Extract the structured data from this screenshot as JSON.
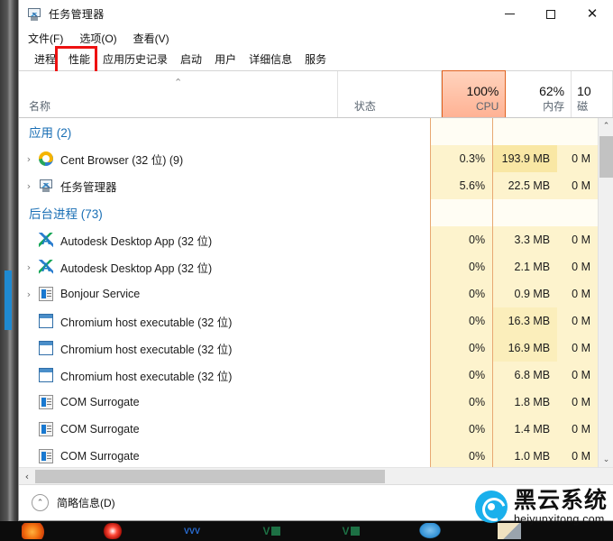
{
  "window": {
    "title": "任务管理器",
    "app_icon": "task-manager-icon",
    "controls": {
      "minimize": "—",
      "maximize": "□",
      "close": "✕"
    }
  },
  "menubar": [
    {
      "label": "文件(F)",
      "mnemonic": "F"
    },
    {
      "label": "选项(O)",
      "mnemonic": "O"
    },
    {
      "label": "查看(V)",
      "mnemonic": "V"
    }
  ],
  "tabs": [
    {
      "label": "进程",
      "active": true
    },
    {
      "label": "性能",
      "active": false,
      "highlighted": true
    },
    {
      "label": "应用历史记录",
      "active": false
    },
    {
      "label": "启动",
      "active": false
    },
    {
      "label": "用户",
      "active": false
    },
    {
      "label": "详细信息",
      "active": false
    },
    {
      "label": "服务",
      "active": false
    }
  ],
  "columns": [
    {
      "key": "name",
      "label": "名称",
      "percent": "",
      "sorted": true,
      "sort_dir": "asc"
    },
    {
      "key": "status",
      "label": "状态",
      "percent": ""
    },
    {
      "key": "cpu",
      "label": "CPU",
      "percent": "100%",
      "highlighted": true
    },
    {
      "key": "mem",
      "label": "内存",
      "percent": "62%"
    },
    {
      "key": "disk",
      "label": "磁",
      "percent": "10"
    }
  ],
  "groups": [
    {
      "label": "应用 (2)"
    },
    {
      "label": "后台进程 (73)"
    }
  ],
  "rows": [
    {
      "type": "group",
      "name": "应用 (2)",
      "status": "",
      "cpu": "",
      "mem": "",
      "disk": "",
      "cpu_heat": 0,
      "mem_heat": 0,
      "disk_heat": 0
    },
    {
      "type": "proc",
      "expandable": true,
      "icon": "cent-browser-icon",
      "name": "Cent Browser (32 位) (9)",
      "status": "",
      "cpu": "0.3%",
      "mem": "193.9 MB",
      "disk": "0 M",
      "cpu_heat": 1,
      "mem_heat": 3,
      "disk_heat": 1
    },
    {
      "type": "proc",
      "expandable": true,
      "icon": "task-manager-icon",
      "name": "任务管理器",
      "status": "",
      "cpu": "5.6%",
      "mem": "22.5 MB",
      "disk": "0 M",
      "cpu_heat": 1,
      "mem_heat": 1,
      "disk_heat": 1
    },
    {
      "type": "group",
      "name": "后台进程 (73)",
      "status": "",
      "cpu": "",
      "mem": "",
      "disk": "",
      "cpu_heat": 0,
      "mem_heat": 0,
      "disk_heat": 0
    },
    {
      "type": "proc",
      "expandable": false,
      "icon": "autodesk-icon",
      "name": "Autodesk Desktop App (32 位)",
      "status": "",
      "cpu": "0%",
      "mem": "3.3 MB",
      "disk": "0 M",
      "cpu_heat": 1,
      "mem_heat": 1,
      "disk_heat": 1
    },
    {
      "type": "proc",
      "expandable": true,
      "icon": "autodesk-icon",
      "name": "Autodesk Desktop App (32 位)",
      "status": "",
      "cpu": "0%",
      "mem": "2.1 MB",
      "disk": "0 M",
      "cpu_heat": 1,
      "mem_heat": 1,
      "disk_heat": 1
    },
    {
      "type": "proc",
      "expandable": true,
      "icon": "service-icon",
      "name": "Bonjour Service",
      "status": "",
      "cpu": "0%",
      "mem": "0.9 MB",
      "disk": "0 M",
      "cpu_heat": 1,
      "mem_heat": 1,
      "disk_heat": 1
    },
    {
      "type": "proc",
      "expandable": false,
      "icon": "window-icon",
      "name": "Chromium host executable (32 位)",
      "status": "",
      "cpu": "0%",
      "mem": "16.3 MB",
      "disk": "0 M",
      "cpu_heat": 1,
      "mem_heat": 2,
      "disk_heat": 1
    },
    {
      "type": "proc",
      "expandable": false,
      "icon": "window-icon",
      "name": "Chromium host executable (32 位)",
      "status": "",
      "cpu": "0%",
      "mem": "16.9 MB",
      "disk": "0 M",
      "cpu_heat": 1,
      "mem_heat": 2,
      "disk_heat": 1
    },
    {
      "type": "proc",
      "expandable": false,
      "icon": "window-icon",
      "name": "Chromium host executable (32 位)",
      "status": "",
      "cpu": "0%",
      "mem": "6.8 MB",
      "disk": "0 M",
      "cpu_heat": 1,
      "mem_heat": 1,
      "disk_heat": 1
    },
    {
      "type": "proc",
      "expandable": false,
      "icon": "service-icon",
      "name": "COM Surrogate",
      "status": "",
      "cpu": "0%",
      "mem": "1.8 MB",
      "disk": "0 M",
      "cpu_heat": 1,
      "mem_heat": 1,
      "disk_heat": 1
    },
    {
      "type": "proc",
      "expandable": false,
      "icon": "service-icon",
      "name": "COM Surrogate",
      "status": "",
      "cpu": "0%",
      "mem": "1.4 MB",
      "disk": "0 M",
      "cpu_heat": 1,
      "mem_heat": 1,
      "disk_heat": 1
    },
    {
      "type": "proc",
      "expandable": false,
      "icon": "service-icon",
      "name": "COM Surrogate",
      "status": "",
      "cpu": "0%",
      "mem": "1.0 MB",
      "disk": "0 M",
      "cpu_heat": 1,
      "mem_heat": 1,
      "disk_heat": 1
    }
  ],
  "statusbar": {
    "fewer_details": "简略信息(D)",
    "mnemonic": "D",
    "chevron": "⌃"
  },
  "scroll": {
    "up": "⌃",
    "down": "⌄",
    "left": "‹",
    "right": "›"
  },
  "watermark": {
    "cn": "黑云系统",
    "en": "heiyunxitong.com"
  },
  "colors": {
    "cpu_header_accent": "#e0621f",
    "group_label": "#1a6fb5",
    "heat_light": "#fffdf4",
    "heat_mid": "#fdf3cd",
    "heat_high": "#f9e7a4",
    "highlight_box": "#ee1111",
    "watermark_blue": "#1ab0ec"
  },
  "taskbar": {
    "items": [
      {
        "name": "firefox-icon"
      },
      {
        "name": "opera-icon"
      },
      {
        "name": "vvv-icon"
      },
      {
        "name": "excel-icon-1"
      },
      {
        "name": "excel-icon-2"
      },
      {
        "name": "mail-icon"
      },
      {
        "name": "document-icon"
      }
    ]
  }
}
